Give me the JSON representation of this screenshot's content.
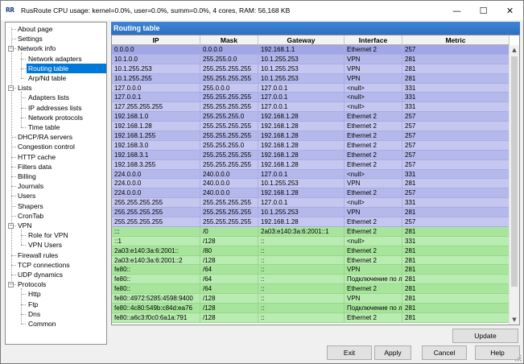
{
  "titlebar": {
    "app_icon_text": "RR",
    "title": "RusRoute   CPU usage: kernel=0.0%, user=0.0%, summ=0.0%, 4 cores,  RAM: 56,168 KB",
    "minimize_glyph": "—",
    "maximize_glyph": "☐",
    "close_glyph": "✕"
  },
  "tree": {
    "expand_glyph": "−",
    "items": [
      {
        "label": "About page"
      },
      {
        "label": "Settings"
      },
      {
        "label": "Network info"
      },
      {
        "label": "Network adapters"
      },
      {
        "label": "Routing table"
      },
      {
        "label": "Arp/Nd table"
      },
      {
        "label": "Lists"
      },
      {
        "label": "Adapters lists"
      },
      {
        "label": "IP addresses lists"
      },
      {
        "label": "Network protocols"
      },
      {
        "label": "Time table"
      },
      {
        "label": "DHCP/RA servers"
      },
      {
        "label": "Congestion control"
      },
      {
        "label": "HTTP cache"
      },
      {
        "label": "Filters data"
      },
      {
        "label": "Billing"
      },
      {
        "label": "Journals"
      },
      {
        "label": "Users"
      },
      {
        "label": "Shapers"
      },
      {
        "label": "CronTab"
      },
      {
        "label": "VPN"
      },
      {
        "label": "Role for VPN"
      },
      {
        "label": "VPN Users"
      },
      {
        "label": "Firewall rules"
      },
      {
        "label": "TCP connections"
      },
      {
        "label": "UDP dynamics"
      },
      {
        "label": "Protocols"
      },
      {
        "label": "Http"
      },
      {
        "label": "Ftp"
      },
      {
        "label": "Dns"
      },
      {
        "label": "Common"
      }
    ]
  },
  "panel": {
    "title": "Routing table",
    "columns": [
      "IP",
      "Mask",
      "Gateway",
      "Interface",
      "Metric"
    ],
    "rows": [
      [
        "0.0.0.0",
        "0.0.0.0",
        "192.168.1.1",
        "Ethernet 2",
        "257"
      ],
      [
        "10.1.0.0",
        "255.255.0.0",
        "10.1.255.253",
        "VPN",
        "281"
      ],
      [
        "10.1.255.253",
        "255.255.255.255",
        "10.1.255.253",
        "VPN",
        "281"
      ],
      [
        "10.1.255.255",
        "255.255.255.255",
        "10.1.255.253",
        "VPN",
        "281"
      ],
      [
        "127.0.0.0",
        "255.0.0.0",
        "127.0.0.1",
        "<null>",
        "331"
      ],
      [
        "127.0.0.1",
        "255.255.255.255",
        "127.0.0.1",
        "<null>",
        "331"
      ],
      [
        "127.255.255.255",
        "255.255.255.255",
        "127.0.0.1",
        "<null>",
        "331"
      ],
      [
        "192.168.1.0",
        "255.255.255.0",
        "192.168.1.28",
        "Ethernet 2",
        "257"
      ],
      [
        "192.168.1.28",
        "255.255.255.255",
        "192.168.1.28",
        "Ethernet 2",
        "257"
      ],
      [
        "192.168.1.255",
        "255.255.255.255",
        "192.168.1.28",
        "Ethernet 2",
        "257"
      ],
      [
        "192.168.3.0",
        "255.255.255.0",
        "192.168.1.28",
        "Ethernet 2",
        "257"
      ],
      [
        "192.168.3.1",
        "255.255.255.255",
        "192.168.1.28",
        "Ethernet 2",
        "257"
      ],
      [
        "192.168.3.255",
        "255.255.255.255",
        "192.168.1.28",
        "Ethernet 2",
        "257"
      ],
      [
        "224.0.0.0",
        "240.0.0.0",
        "127.0.0.1",
        "<null>",
        "331"
      ],
      [
        "224.0.0.0",
        "240.0.0.0",
        "10.1.255.253",
        "VPN",
        "281"
      ],
      [
        "224.0.0.0",
        "240.0.0.0",
        "192.168.1.28",
        "Ethernet 2",
        "257"
      ],
      [
        "255.255.255.255",
        "255.255.255.255",
        "127.0.0.1",
        "<null>",
        "331"
      ],
      [
        "255.255.255.255",
        "255.255.255.255",
        "10.1.255.253",
        "VPN",
        "281"
      ],
      [
        "255.255.255.255",
        "255.255.255.255",
        "192.168.1.28",
        "Ethernet 2",
        "257"
      ],
      [
        ":::",
        "/0",
        "2a03:e140:3a:6:2001::1",
        "Ethernet 2",
        "281"
      ],
      [
        "::1",
        "/128",
        "::",
        "<null>",
        "331"
      ],
      [
        "2a03:e140:3a:6:2001::",
        "/80",
        "::",
        "Ethernet 2",
        "281"
      ],
      [
        "2a03:e140:3a:6:2001::2",
        "/128",
        "::",
        "Ethernet 2",
        "281"
      ],
      [
        "fe80::",
        "/64",
        "::",
        "VPN",
        "281"
      ],
      [
        "fe80::",
        "/64",
        "::",
        "Подключение по л",
        "281"
      ],
      [
        "fe80::",
        "/64",
        "::",
        "Ethernet 2",
        "281"
      ],
      [
        "fe80::4972:5285:4598:9400",
        "/128",
        "::",
        "VPN",
        "281"
      ],
      [
        "fe80::4c80:549b:c84d:ea76",
        "/128",
        "::",
        "Подключение по л",
        "281"
      ],
      [
        "fe80::a6c3:f0c0:6a1a:791",
        "/128",
        "::",
        "Ethernet 2",
        "281"
      ]
    ]
  },
  "buttons": {
    "update": "Update",
    "exit": "Exit",
    "apply": "Apply",
    "cancel": "Cancel",
    "help": "Help"
  },
  "scrollbar": {
    "up": "▲",
    "down": "▼"
  },
  "colors": {
    "ipv4_row": "#c5c7f0",
    "ipv6_row": "#b9ecb0",
    "header": "#2d6fc0",
    "selection": "#0078d7"
  }
}
